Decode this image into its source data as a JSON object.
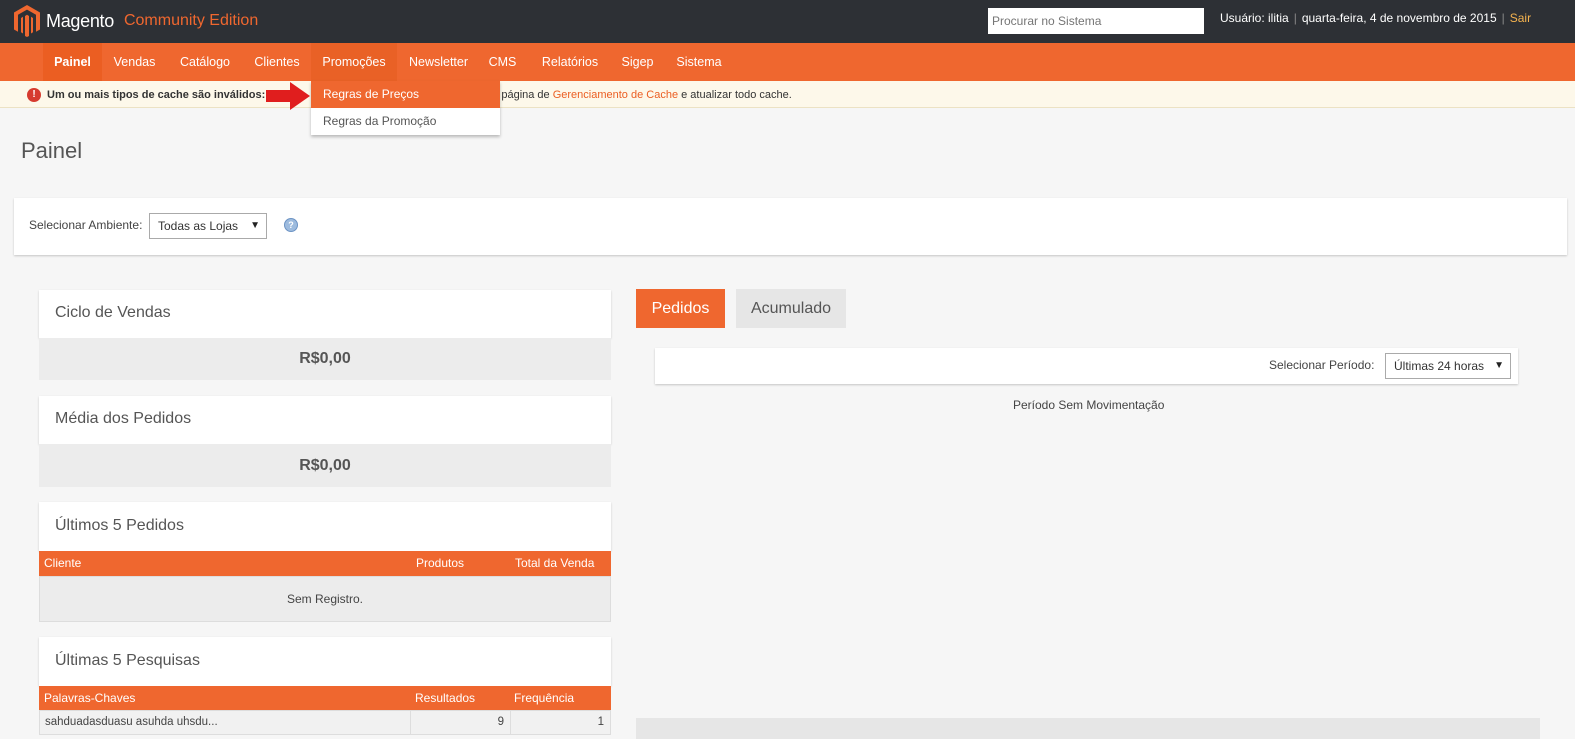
{
  "header": {
    "brand": "Magento",
    "edition": "Community Edition",
    "search_placeholder": "Procurar no Sistema",
    "user_label": "Usuário: ilitia",
    "date": "quarta-feira, 4 de novembro de 2015",
    "logout": "Sair"
  },
  "nav": {
    "items": [
      {
        "label": "Painel"
      },
      {
        "label": "Vendas"
      },
      {
        "label": "Catálogo"
      },
      {
        "label": "Clientes"
      },
      {
        "label": "Promoções"
      },
      {
        "label": "Newsletter"
      },
      {
        "label": "CMS"
      },
      {
        "label": "Relatórios"
      },
      {
        "label": "Sigep"
      },
      {
        "label": "Sistema"
      }
    ],
    "dropdown": [
      {
        "label": "Regras de Preços"
      },
      {
        "label": "Regras da Promoção"
      }
    ]
  },
  "message": {
    "bold": "Um ou mais tipos de cache são inválidos:",
    "pre": "ir a página de ",
    "link": "Gerenciamento de Cache",
    "post": " e atualizar todo cache."
  },
  "page": {
    "title": "Painel"
  },
  "switcher": {
    "label": "Selecionar Ambiente:",
    "value": "Todas as Lojas"
  },
  "lifetime_sales": {
    "title": "Ciclo de Vendas",
    "value": "R$0,00"
  },
  "average_order": {
    "title": "Média dos Pedidos",
    "value": "R$0,00"
  },
  "last_orders": {
    "title": "Últimos 5 Pedidos",
    "columns": [
      "Cliente",
      "Produtos",
      "Total da Venda"
    ],
    "empty": "Sem Registro."
  },
  "last_searches": {
    "title": "Últimas 5 Pesquisas",
    "columns": [
      "Palavras-Chaves",
      "Resultados",
      "Frequência"
    ],
    "rows": [
      {
        "keyword": "sahduadasduasu asuhda uhsdu...",
        "results": "9",
        "frequency": "1"
      }
    ]
  },
  "chart_panel": {
    "tabs": [
      {
        "label": "Pedidos"
      },
      {
        "label": "Acumulado"
      }
    ],
    "period_label": "Selecionar Período:",
    "period_value": "Últimas 24 horas",
    "no_data": "Período Sem Movimentação"
  },
  "colors": {
    "header_bg": "#2d3035",
    "accent": "#ef672f",
    "logout_link": "#f5b34f"
  }
}
